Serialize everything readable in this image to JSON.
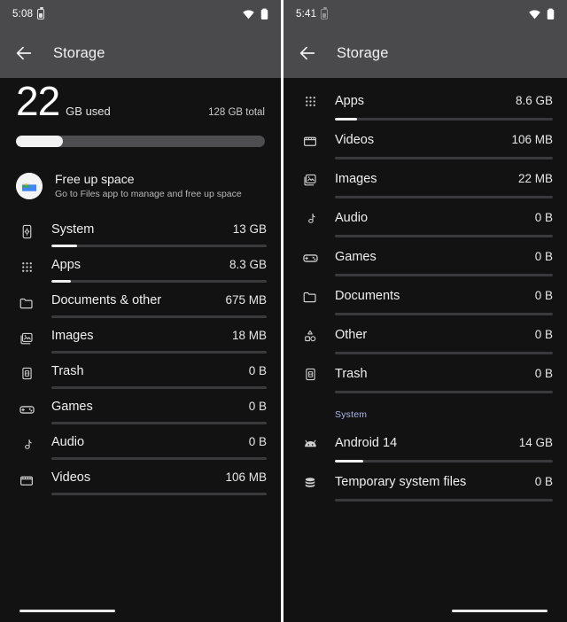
{
  "left_phone": {
    "status_bar": {
      "clock": "5:08",
      "battery_icon": "battery-icon",
      "wifi_icon": "wifi-icon",
      "signal_battery_icon": "battery-icon"
    },
    "app_bar": {
      "back_icon": "back-arrow-icon",
      "title": "Storage"
    },
    "summary": {
      "used_value": "22",
      "used_unit": "GB used",
      "total_text": "128 GB total",
      "bar_fill_percent": 19
    },
    "free_up_space": {
      "icon": "files-app-icon",
      "title": "Free up space",
      "subtitle": "Go to Files app to manage and free up space"
    },
    "rows": [
      {
        "icon": "device-system-icon",
        "label": "System",
        "size": "13 GB",
        "bar_percent": 12
      },
      {
        "icon": "apps-grid-icon",
        "label": "Apps",
        "size": "8.3 GB",
        "bar_percent": 9
      },
      {
        "icon": "folder-icon",
        "label": "Documents & other",
        "size": "675 MB",
        "bar_percent": 0
      },
      {
        "icon": "images-icon",
        "label": "Images",
        "size": "18 MB",
        "bar_percent": 0
      },
      {
        "icon": "trash-icon",
        "label": "Trash",
        "size": "0 B",
        "bar_percent": 0
      },
      {
        "icon": "games-controller-icon",
        "label": "Games",
        "size": "0 B",
        "bar_percent": 0
      },
      {
        "icon": "audio-note-icon",
        "label": "Audio",
        "size": "0 B",
        "bar_percent": 0
      },
      {
        "icon": "videos-icon",
        "label": "Videos",
        "size": "106 MB",
        "bar_percent": 0
      }
    ],
    "home_indicator": "home-indicator"
  },
  "right_phone": {
    "status_bar": {
      "clock": "5:41",
      "battery_icon": "battery-icon",
      "wifi_icon": "wifi-icon"
    },
    "app_bar": {
      "back_icon": "back-arrow-icon",
      "title": "Storage"
    },
    "rows": [
      {
        "icon": "apps-grid-icon",
        "label": "Apps",
        "size": "8.6 GB",
        "bar_percent": 10
      },
      {
        "icon": "videos-icon",
        "label": "Videos",
        "size": "106 MB",
        "bar_percent": 0
      },
      {
        "icon": "images-icon",
        "label": "Images",
        "size": "22 MB",
        "bar_percent": 0
      },
      {
        "icon": "audio-note-icon",
        "label": "Audio",
        "size": "0 B",
        "bar_percent": 0
      },
      {
        "icon": "games-controller-icon",
        "label": "Games",
        "size": "0 B",
        "bar_percent": 0
      },
      {
        "icon": "folder-icon",
        "label": "Documents",
        "size": "0 B",
        "bar_percent": 0
      },
      {
        "icon": "other-shapes-icon",
        "label": "Other",
        "size": "0 B",
        "bar_percent": 0
      },
      {
        "icon": "trash-icon",
        "label": "Trash",
        "size": "0 B",
        "bar_percent": 0
      }
    ],
    "system_section": {
      "header": "System",
      "rows": [
        {
          "icon": "android-robot-icon",
          "label": "Android 14",
          "size": "14 GB",
          "bar_percent": 13
        },
        {
          "icon": "database-stack-icon",
          "label": "Temporary system files",
          "size": "0 B",
          "bar_percent": 0
        }
      ]
    },
    "home_indicator": "home-indicator"
  },
  "theme": {
    "background": "#121212",
    "app_bar": "#4a4a4c",
    "accent_text": "#b0b6e8",
    "bar_fill": "#f0f0f0",
    "bar_track": "#3a3a3c"
  }
}
